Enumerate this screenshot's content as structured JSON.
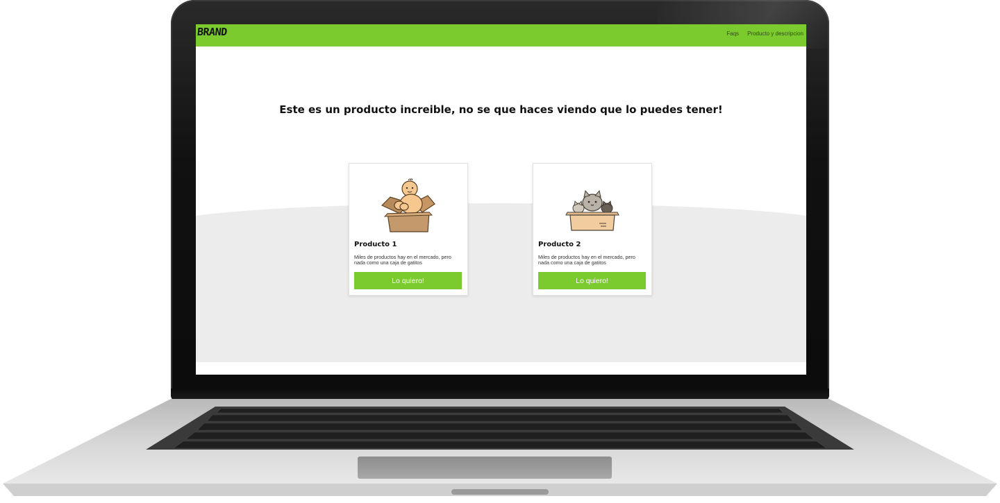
{
  "brand": "BRAND",
  "nav": {
    "links": [
      "Faqs",
      "Producto y descripcion"
    ]
  },
  "hero": {
    "title": "Este es un producto increible, no se que haces viendo que lo puedes tener!"
  },
  "products": [
    {
      "title": "Producto 1",
      "description": "Miles de productos hay en el mercado, pero nada como una caja de gatitos",
      "button": "Lo quiero!",
      "image": "baby-in-box-illustration"
    },
    {
      "title": "Producto 2",
      "description": "Miles de productos hay en el mercado, pero nada como una caja de gatitos",
      "button": "Lo quiero!",
      "image": "cats-in-box-illustration"
    }
  ],
  "colors": {
    "accent": "#7bcb2f",
    "laptop_frame": "#111111",
    "laptop_base": "#c8c8c8"
  }
}
